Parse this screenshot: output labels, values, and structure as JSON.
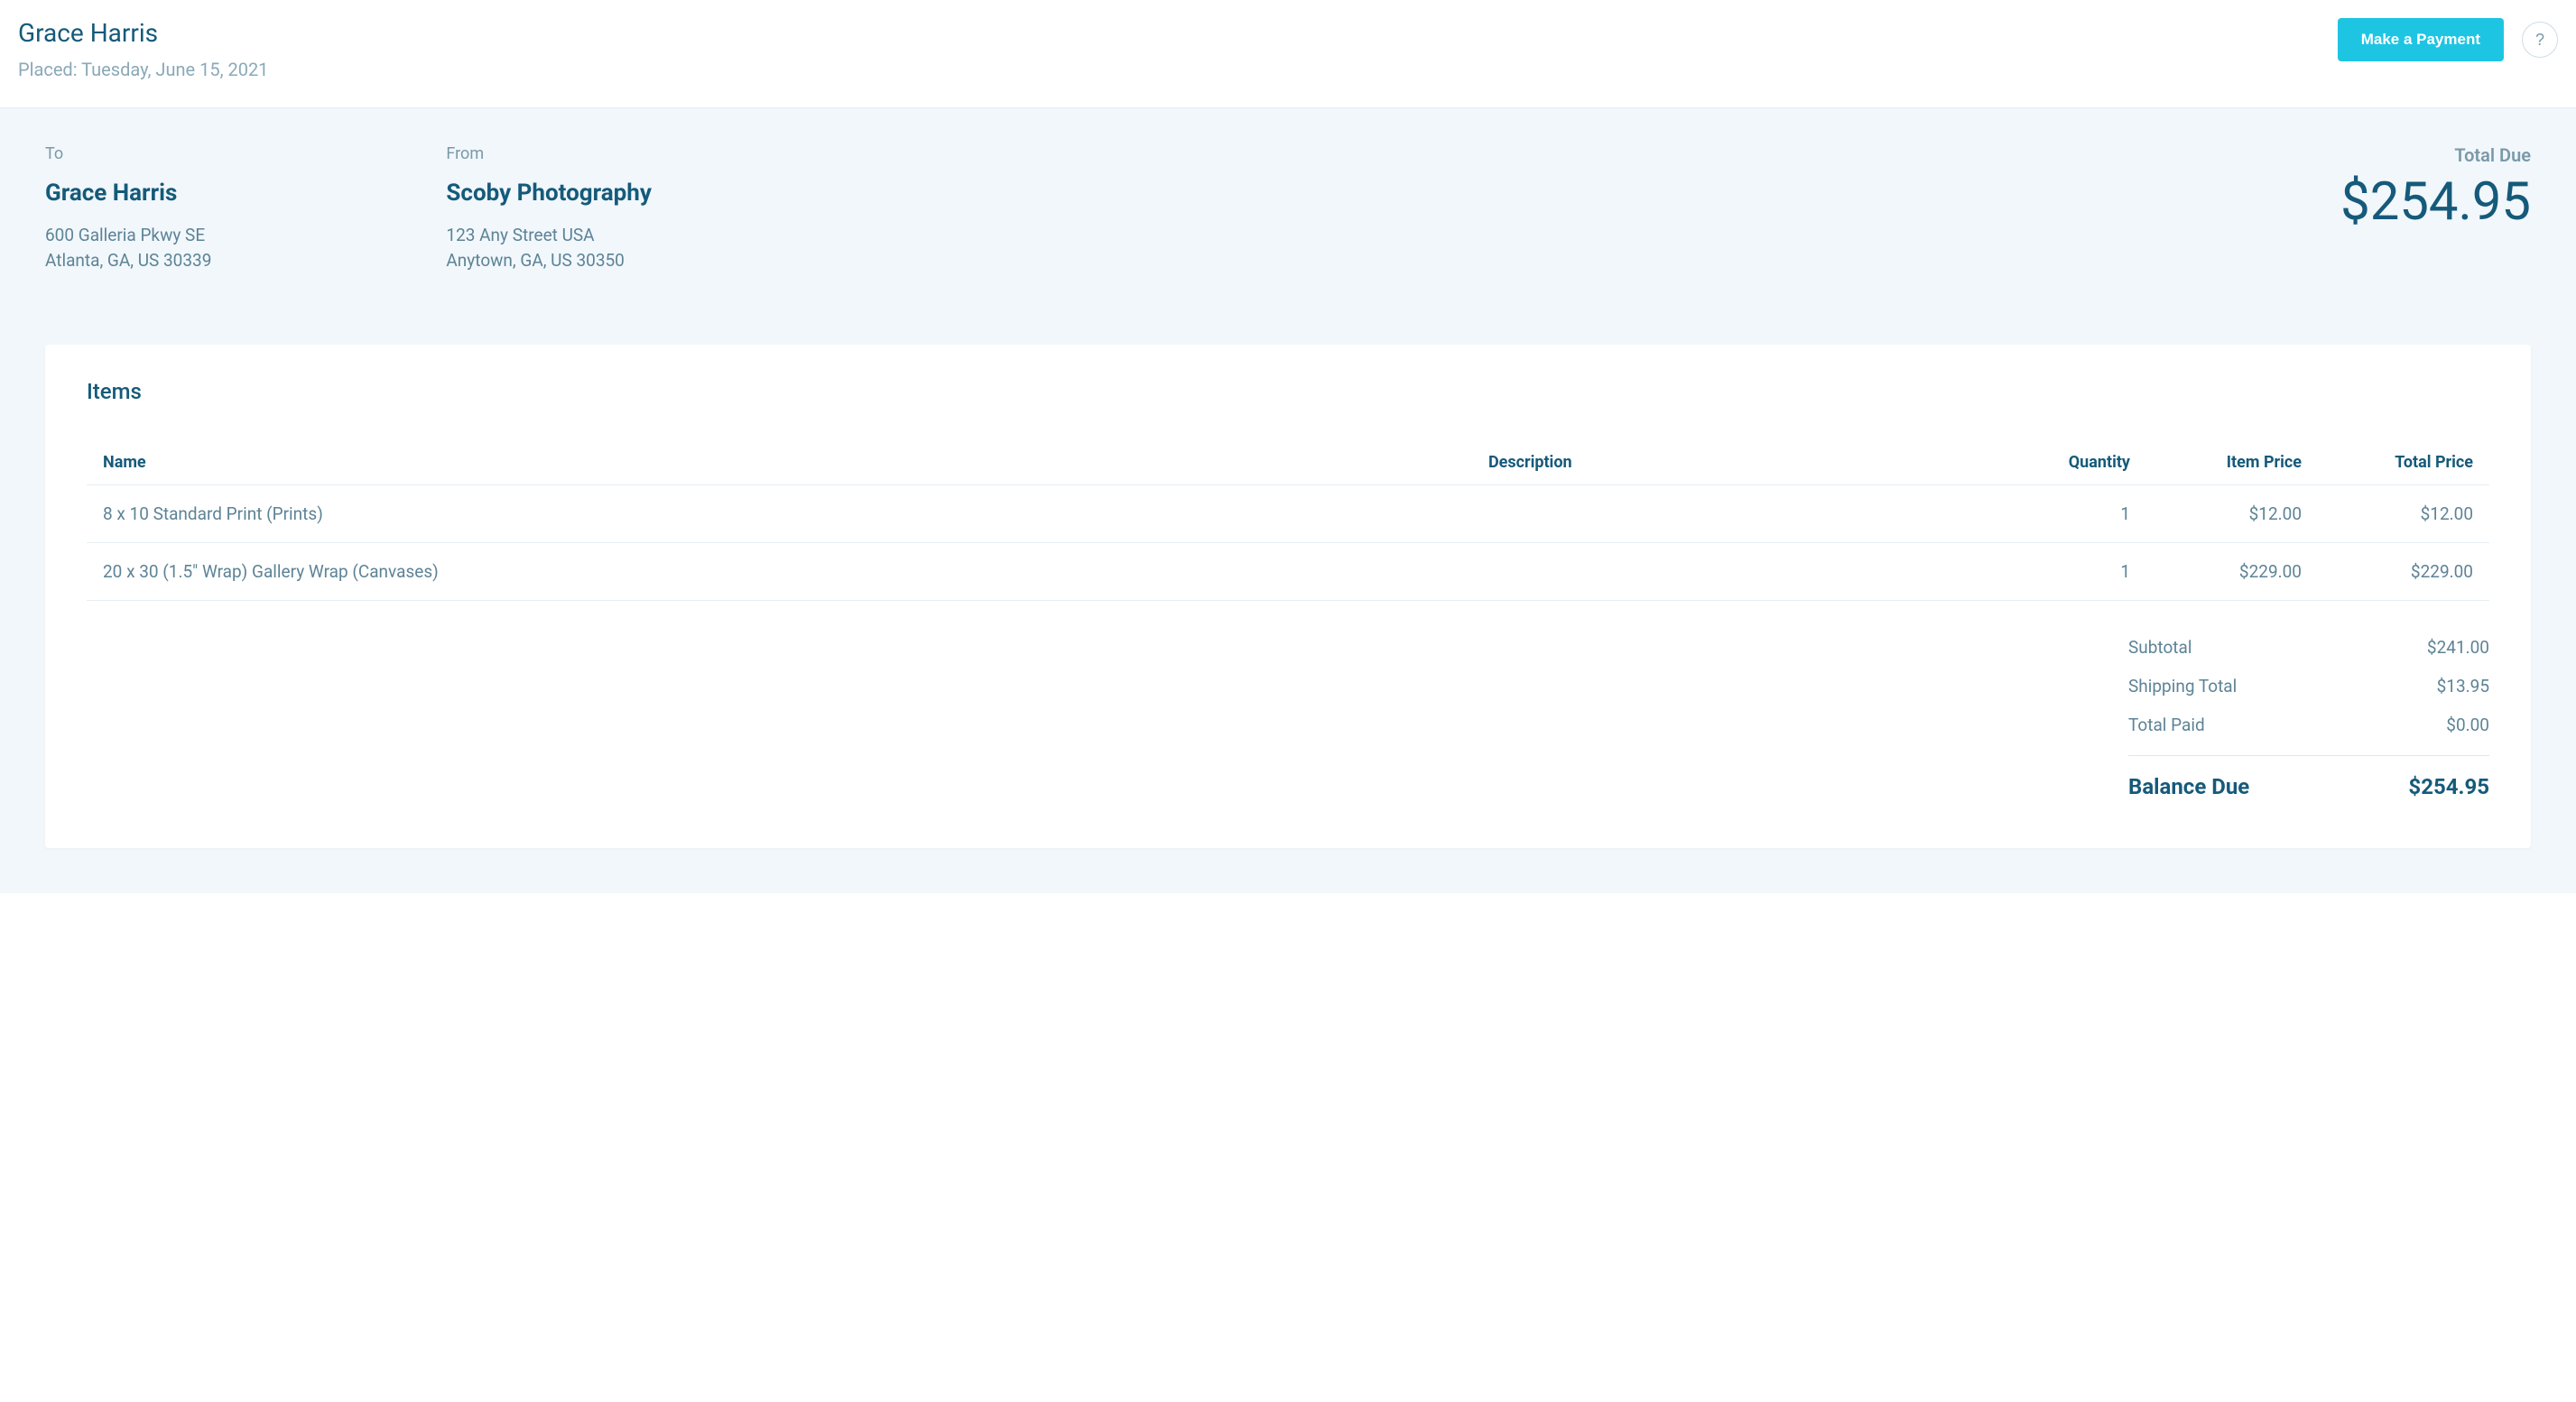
{
  "header": {
    "customer_name": "Grace Harris",
    "placed_label": "Placed: Tuesday, June 15, 2021",
    "make_payment_label": "Make a Payment",
    "help_icon": "?"
  },
  "to": {
    "label": "To",
    "name": "Grace Harris",
    "address_line1": "600 Galleria Pkwy SE",
    "address_line2": "Atlanta, GA, US 30339"
  },
  "from": {
    "label": "From",
    "name": "Scoby Photography",
    "address_line1": "123 Any Street USA",
    "address_line2": "Anytown, GA, US 30350"
  },
  "total_due": {
    "label": "Total Due",
    "amount": "$254.95"
  },
  "items_section": {
    "title": "Items",
    "columns": {
      "name": "Name",
      "description": "Description",
      "quantity": "Quantity",
      "item_price": "Item Price",
      "total_price": "Total Price"
    },
    "rows": [
      {
        "name": "8 x 10 Standard Print (Prints)",
        "description": "",
        "quantity": "1",
        "item_price": "$12.00",
        "total_price": "$12.00"
      },
      {
        "name": "20 x 30 (1.5\" Wrap) Gallery Wrap (Canvases)",
        "description": "",
        "quantity": "1",
        "item_price": "$229.00",
        "total_price": "$229.00"
      }
    ]
  },
  "totals": {
    "subtotal_label": "Subtotal",
    "subtotal_value": "$241.00",
    "shipping_label": "Shipping Total",
    "shipping_value": "$13.95",
    "paid_label": "Total Paid",
    "paid_value": "$0.00",
    "balance_label": "Balance Due",
    "balance_value": "$254.95"
  }
}
